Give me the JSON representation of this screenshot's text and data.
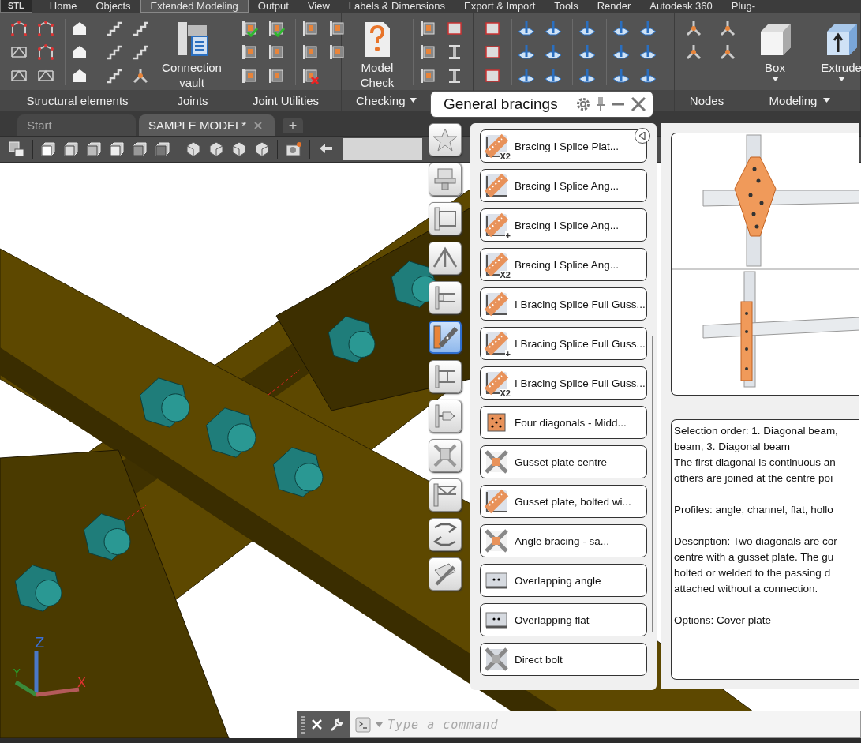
{
  "app_button": "STL",
  "menu_tabs": [
    {
      "label": "Home",
      "selected": false
    },
    {
      "label": "Objects",
      "selected": false
    },
    {
      "label": "Extended Modeling",
      "selected": true
    },
    {
      "label": "Output",
      "selected": false
    },
    {
      "label": "View",
      "selected": false
    },
    {
      "label": "Labels & Dimensions",
      "selected": false
    },
    {
      "label": "Export & Import",
      "selected": false
    },
    {
      "label": "Tools",
      "selected": false
    },
    {
      "label": "Render",
      "selected": false
    },
    {
      "label": "Autodesk 360",
      "selected": false
    },
    {
      "label": "Plug-",
      "selected": false
    }
  ],
  "ribbon": {
    "panels": [
      {
        "label": "Structural elements",
        "dropdown": false
      },
      {
        "label": "Joints",
        "dropdown": false,
        "big_buttons": [
          {
            "label": "Connection vault",
            "dropdown": false
          }
        ]
      },
      {
        "label": "Joint Utilities",
        "dropdown": false
      },
      {
        "label": "Checking",
        "dropdown": true,
        "big_buttons": [
          {
            "label": "Model Check",
            "dropdown": false
          }
        ]
      },
      {
        "label": "Nodes",
        "dropdown": false
      },
      {
        "label": "Modeling",
        "dropdown": true,
        "big_buttons": [
          {
            "label": "Box",
            "dropdown": true
          },
          {
            "label": "Extrude",
            "dropdown": true
          }
        ]
      }
    ]
  },
  "documents": {
    "tabs": [
      {
        "label": "Start",
        "selected": false,
        "closable": false
      },
      {
        "label": "SAMPLE MODEL*",
        "selected": true,
        "closable": true
      }
    ],
    "new_tab": "+"
  },
  "viewport": {
    "axis_labels": [
      "Z",
      "Y",
      "X"
    ]
  },
  "palette": {
    "title": "General bracings",
    "categories": [
      {
        "selected": false
      },
      {
        "selected": false
      },
      {
        "selected": false
      },
      {
        "selected": false
      },
      {
        "selected": false
      },
      {
        "selected": true
      },
      {
        "selected": false
      },
      {
        "selected": false
      },
      {
        "selected": false
      },
      {
        "selected": false
      },
      {
        "selected": false
      },
      {
        "selected": false
      }
    ],
    "items": [
      {
        "label": "Bracing I Splice Plat...",
        "badge": "X2"
      },
      {
        "label": "Bracing I Splice Ang..."
      },
      {
        "label": "Bracing I Splice Ang...",
        "badge": "+"
      },
      {
        "label": "Bracing I Splice Ang...",
        "badge": "X2"
      },
      {
        "label": "I Bracing Splice Full Guss..."
      },
      {
        "label": "I Bracing Splice Full Guss...",
        "badge": "+"
      },
      {
        "label": "I Bracing Splice Full Guss...",
        "badge": "X2"
      },
      {
        "label": "Four diagonals - Midd..."
      },
      {
        "label": "Gusset plate centre"
      },
      {
        "label": "Gusset plate, bolted wi..."
      },
      {
        "label": "Angle bracing - sa..."
      },
      {
        "label": "Overlapping angle"
      },
      {
        "label": "Overlapping flat"
      },
      {
        "label": "Direct bolt"
      }
    ],
    "description": [
      [
        "Selection order: 1. Diagonal beam,",
        "beam, 3. Diagonal beam",
        "The first diagonal is continuous an",
        "others are joined at the centre poi"
      ],
      [
        "Profiles: angle, channel, flat, hollo"
      ],
      [
        "Description: Two diagonals are cor",
        "centre with a gusset plate. The gu",
        "bolted or welded to the passing d",
        "attached without a connection."
      ],
      [
        "Options: Cover plate"
      ]
    ]
  },
  "command_line": {
    "placeholder": "Type a command"
  }
}
